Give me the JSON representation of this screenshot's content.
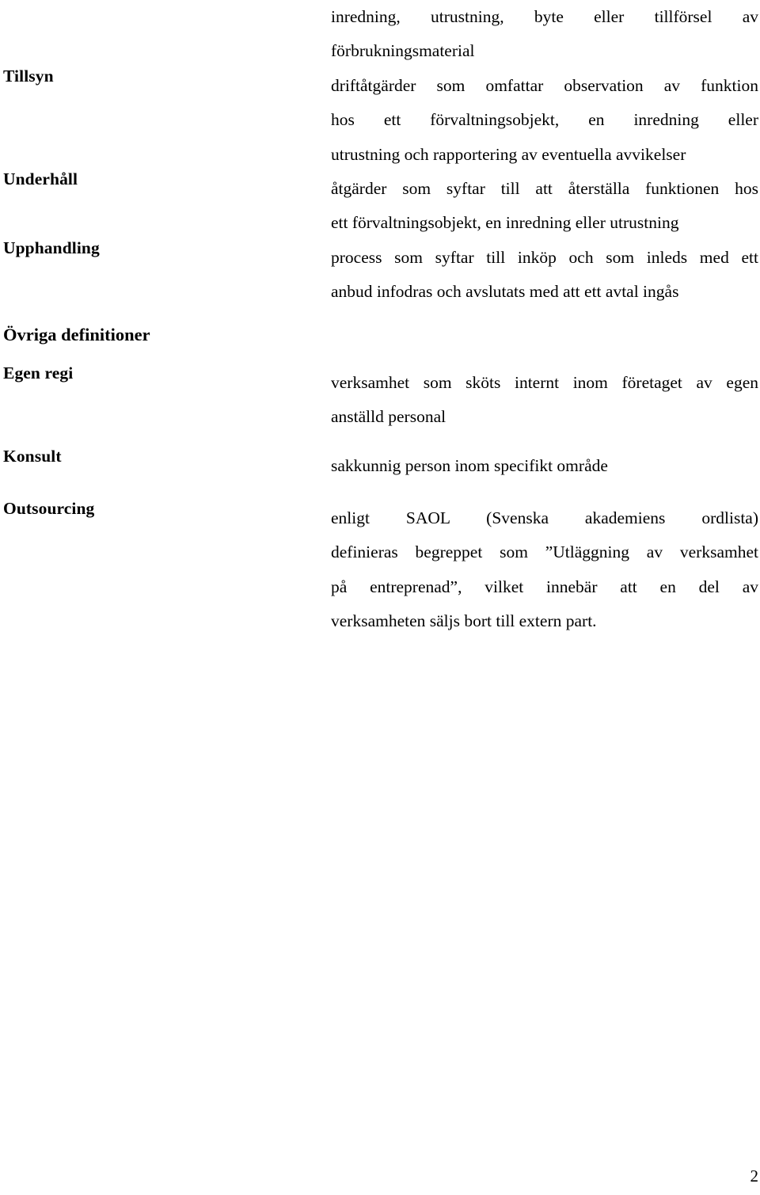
{
  "document": {
    "language": "sv",
    "page_number": "2"
  },
  "terms": [
    {
      "label": "Tillsyn"
    },
    {
      "label": "Underhåll"
    },
    {
      "label": "Upphandling"
    },
    {
      "label": "Egen regi"
    },
    {
      "label": "Konsult"
    },
    {
      "label": "Outsourcing"
    }
  ],
  "section_heading": "Övriga definitioner",
  "definitions": {
    "continuation": {
      "lines": [
        "inredning, utrustning, byte eller tillförsel av",
        "förbrukningsmaterial"
      ]
    },
    "tillsyn": {
      "lines": [
        "driftåtgärder som omfattar observation av funktion",
        "hos ett förvaltningsobjekt, en inredning eller",
        "utrustning och rapportering av eventuella avvikelser"
      ]
    },
    "underhall": {
      "lines": [
        "åtgärder som syftar till att återställa funktionen hos",
        "ett förvaltningsobjekt, en inredning eller utrustning"
      ]
    },
    "upphandling": {
      "lines": [
        "process som syftar till inköp och som inleds med ett",
        "anbud infodras och avslutats med att ett avtal ingås"
      ]
    },
    "egen_regi": {
      "lines": [
        "verksamhet som sköts internt inom företaget av egen",
        "anställd personal"
      ]
    },
    "konsult": {
      "lines": [
        "sakkunnig person inom specifikt område"
      ]
    },
    "outsourcing": {
      "lines": [
        "enligt SAOL (Svenska akademiens ordlista)",
        "definieras begreppet som ”Utläggning av verksamhet",
        "på entreprenad”, vilket innebär att en del av",
        "verksamheten säljs bort till extern part."
      ]
    }
  }
}
